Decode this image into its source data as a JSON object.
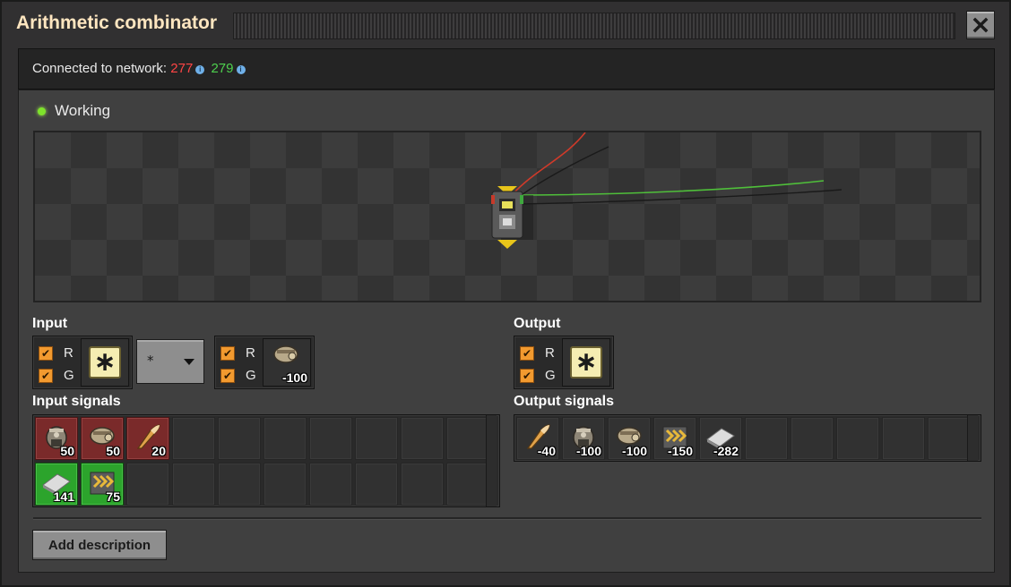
{
  "window": {
    "title": "Arithmetic combinator",
    "close_icon": "close-x-icon"
  },
  "network": {
    "label": "Connected to network:",
    "red_id": "277",
    "green_id": "279"
  },
  "status": {
    "text": "Working",
    "color": "#7ee32b"
  },
  "input": {
    "label": "Input",
    "first": {
      "red_label": "R",
      "green_label": "G",
      "red_checked": true,
      "green_checked": true,
      "signal_icon": "each-signal-icon",
      "signal_glyph": "∗"
    },
    "operator": "*",
    "second": {
      "red_label": "R",
      "green_label": "G",
      "red_checked": true,
      "green_checked": true,
      "signal_icon": "engine-unit-icon",
      "constant": "-100"
    }
  },
  "output": {
    "label": "Output",
    "red_label": "R",
    "green_label": "G",
    "red_checked": true,
    "green_checked": true,
    "signal_icon": "each-signal-icon",
    "signal_glyph": "∗"
  },
  "input_signals": {
    "label": "Input signals",
    "items": [
      {
        "icon": "electric-engine-icon",
        "count": "50",
        "wire": "red"
      },
      {
        "icon": "engine-unit-icon",
        "count": "50",
        "wire": "red"
      },
      {
        "icon": "bullet-icon",
        "count": "20",
        "wire": "red"
      },
      {
        "icon": "steel-plate-icon",
        "count": "141",
        "wire": "green"
      },
      {
        "icon": "belt-icon",
        "count": "75",
        "wire": "green"
      }
    ]
  },
  "output_signals": {
    "label": "Output signals",
    "items": [
      {
        "icon": "bullet-icon",
        "count": "-40"
      },
      {
        "icon": "electric-engine-icon",
        "count": "-100"
      },
      {
        "icon": "engine-unit-icon",
        "count": "-100"
      },
      {
        "icon": "belt-icon",
        "count": "-150"
      },
      {
        "icon": "steel-plate-icon",
        "count": "-282"
      }
    ]
  },
  "description_button": "Add description"
}
